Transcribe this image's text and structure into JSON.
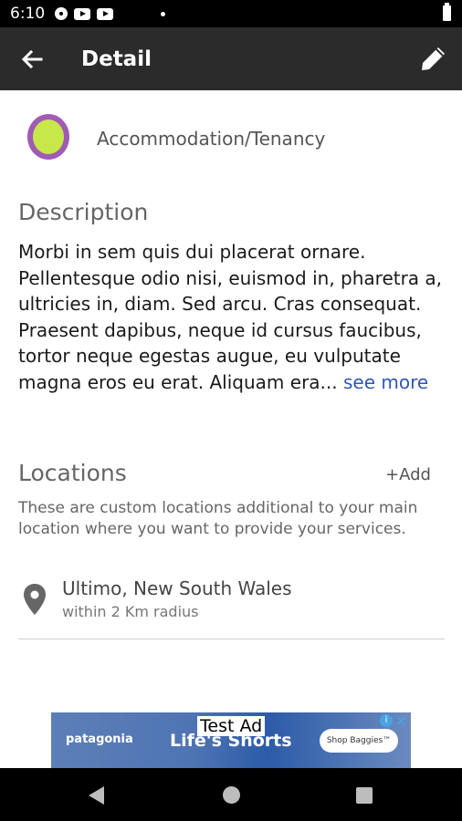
{
  "status_bar": {
    "time": "6:10"
  },
  "app_bar": {
    "title": "Detail"
  },
  "category": {
    "label": "Accommodation/Tenancy"
  },
  "description": {
    "title": "Description",
    "text": "Morbi in sem quis dui placerat ornare. Pellentesque odio nisi, euismod in, pharetra a, ultricies in, diam. Sed arcu. Cras consequat.  Praesent dapibus, neque id cursus faucibus, tortor neque egestas augue, eu vulputate magna eros eu erat. Aliquam era...",
    "see_more": "see more"
  },
  "locations": {
    "title": "Locations",
    "add_label": "+Add",
    "hint": "These are custom locations additional to your main location where you want to provide your services.",
    "items": [
      {
        "name": "Ultimo, New South Wales",
        "radius": "within 2 Km radius"
      }
    ]
  },
  "ad": {
    "label": "Test Ad",
    "brand": "patagonia",
    "headline": "Life's Shorts",
    "cta": "Shop Baggies™"
  },
  "colors": {
    "app_bar": "#2b2b2b",
    "link": "#2e56b6",
    "category_ring": "#a05bb3",
    "category_fill": "#c6e84a"
  }
}
